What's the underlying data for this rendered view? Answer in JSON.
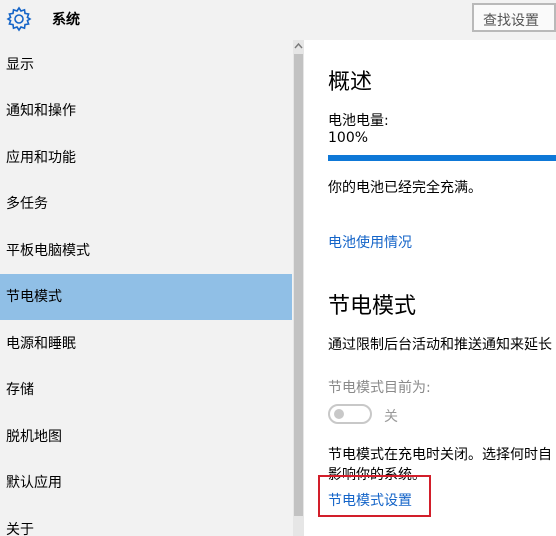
{
  "header": {
    "title": "系统",
    "search_label": "查找设置",
    "icon": "gear-icon"
  },
  "sidebar": {
    "items": [
      {
        "label": "显示",
        "selected": false
      },
      {
        "label": "通知和操作",
        "selected": false
      },
      {
        "label": "应用和功能",
        "selected": false
      },
      {
        "label": "多任务",
        "selected": false
      },
      {
        "label": "平板电脑模式",
        "selected": false
      },
      {
        "label": "节电模式",
        "selected": true
      },
      {
        "label": "电源和睡眠",
        "selected": false
      },
      {
        "label": "存储",
        "selected": false
      },
      {
        "label": "脱机地图",
        "selected": false
      },
      {
        "label": "默认应用",
        "selected": false
      },
      {
        "label": "关于",
        "selected": false
      }
    ],
    "selected_color": "#90bfe6"
  },
  "main": {
    "overview_title": "概述",
    "battery_label": "电池电量:",
    "battery_value": "100%",
    "battery_level": 1.0,
    "battery_status": "你的电池已经完全充满。",
    "battery_usage_link": "电池使用情况",
    "saver_title": "节电模式",
    "saver_desc": "通过限制后台活动和推送通知来延长",
    "saver_current_label": "节电模式目前为:",
    "saver_toggle_state": "关",
    "saver_note_line1": "节电模式在充电时关闭。选择何时自",
    "saver_note_line2": "影响你的系统。",
    "saver_settings_link": "节电模式设置"
  },
  "colors": {
    "accent": "#0e78d7",
    "link": "#1464c8",
    "highlight": "#d21e2a"
  }
}
